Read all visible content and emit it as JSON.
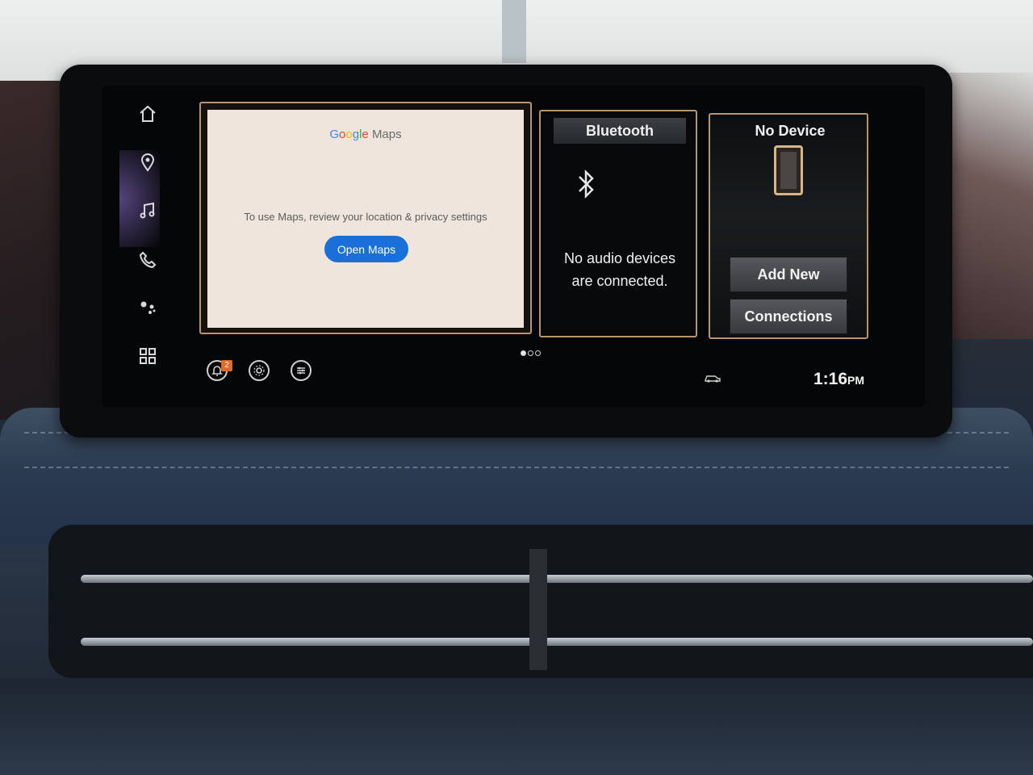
{
  "rail": {
    "icons": [
      "home-icon",
      "location-pin-icon",
      "music-note-icon",
      "phone-icon",
      "assistant-icon",
      "apps-grid-icon"
    ]
  },
  "maps_widget": {
    "logo_google": "Google",
    "logo_maps": "Maps",
    "message": "To use Maps, review your location & privacy settings",
    "button_label": "Open Maps"
  },
  "bluetooth_widget": {
    "title": "Bluetooth",
    "message_line1": "No audio devices",
    "message_line2": "are connected."
  },
  "device_widget": {
    "title": "No Device",
    "add_new_label": "Add New",
    "connections_label": "Connections"
  },
  "pager": {
    "total": 3,
    "active": 1
  },
  "status_bar": {
    "notification_count": "2",
    "time": "1:16",
    "ampm": "PM"
  },
  "colors": {
    "accent_border": "#b8956a",
    "maps_button": "#1a6fd8",
    "badge": "#e06a2b"
  }
}
